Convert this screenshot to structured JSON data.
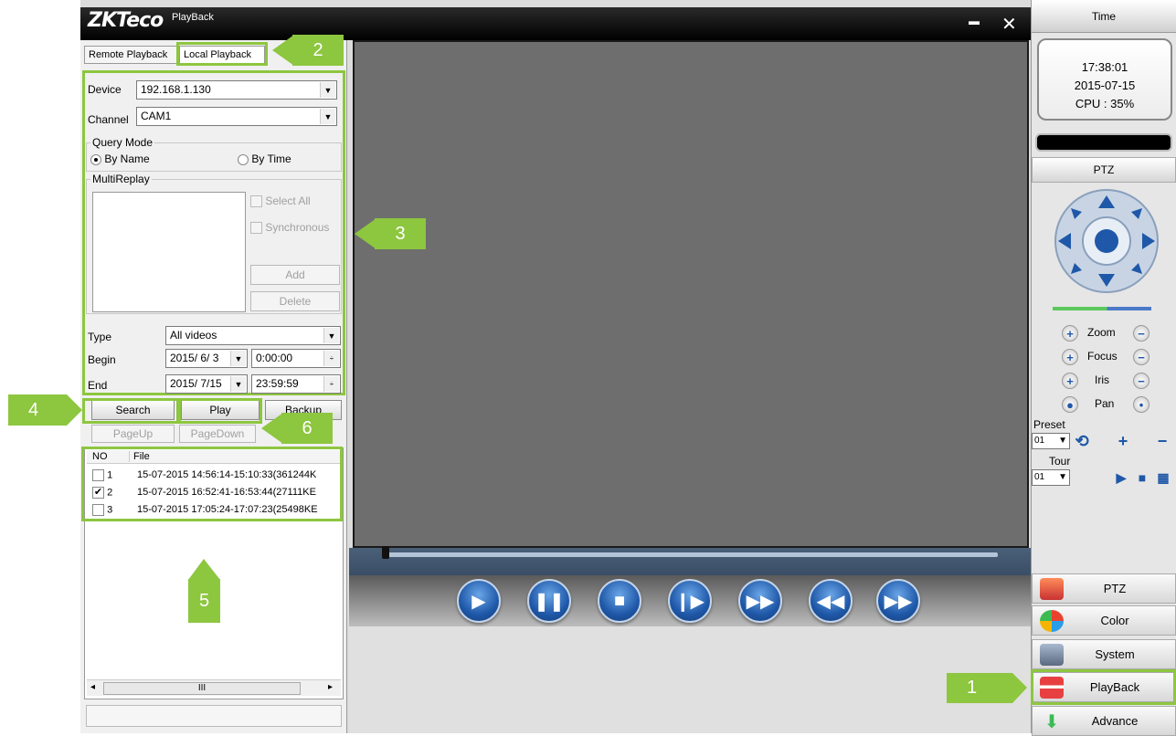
{
  "app": {
    "logo": "ZKTeco",
    "title": "PlayBack",
    "close": "✕",
    "menu_icon": "▬"
  },
  "tabs": [
    {
      "label": "Remote Playback"
    },
    {
      "label": "Local Playback"
    }
  ],
  "form": {
    "device_label": "Device",
    "device_value": "192.168.1.130",
    "channel_label": "Channel",
    "channel_value": "CAM1",
    "query_mode_title": "Query Mode",
    "by_name": "By Name",
    "by_time": "By Time",
    "multireplay_title": "MultiReplay",
    "select_all": "Select All",
    "synchronous": "Synchronous",
    "add": "Add",
    "delete": "Delete",
    "type_label": "Type",
    "type_value": "All videos",
    "begin_label": "Begin",
    "begin_date": "2015/ 6/ 3",
    "begin_time": "0:00:00",
    "end_label": "End",
    "end_date": "2015/ 7/15",
    "end_time": "23:59:59"
  },
  "actions": {
    "search": "Search",
    "play": "Play",
    "backup": "Backup",
    "pageup": "PageUp",
    "pagedown": "PageDown"
  },
  "file_table": {
    "headers": [
      "NO",
      "File"
    ],
    "rows": [
      {
        "no": "1",
        "file": "15-07-2015 14:56:14-15:10:33(361244K",
        "checked": false
      },
      {
        "no": "2",
        "file": "15-07-2015 16:52:41-16:53:44(27111KE",
        "checked": true
      },
      {
        "no": "3",
        "file": "15-07-2015 17:05:24-17:07:23(25498KE",
        "checked": false
      }
    ],
    "hscroll_glyph": "III"
  },
  "callouts": [
    "1",
    "2",
    "3",
    "4",
    "5",
    "6"
  ],
  "player": {
    "buttons": [
      "play",
      "pause",
      "stop",
      "step",
      "fast-forward",
      "previous",
      "next"
    ]
  },
  "right": {
    "time_header": "Time",
    "time": "17:38:01",
    "date": "2015-07-15",
    "cpu": "CPU : 35%",
    "ptz_header": "PTZ",
    "zoom": "Zoom",
    "focus": "Focus",
    "iris": "Iris",
    "pan": "Pan",
    "preset_label": "Preset",
    "preset_value": "01",
    "tour_label": "Tour",
    "tour_value": "01",
    "menu": [
      {
        "label": "PTZ"
      },
      {
        "label": "Color"
      },
      {
        "label": "System"
      },
      {
        "label": "PlayBack"
      },
      {
        "label": "Advance"
      }
    ]
  },
  "colors": {
    "callout": "#8dc63f",
    "accent_blue": "#1f58a8"
  }
}
